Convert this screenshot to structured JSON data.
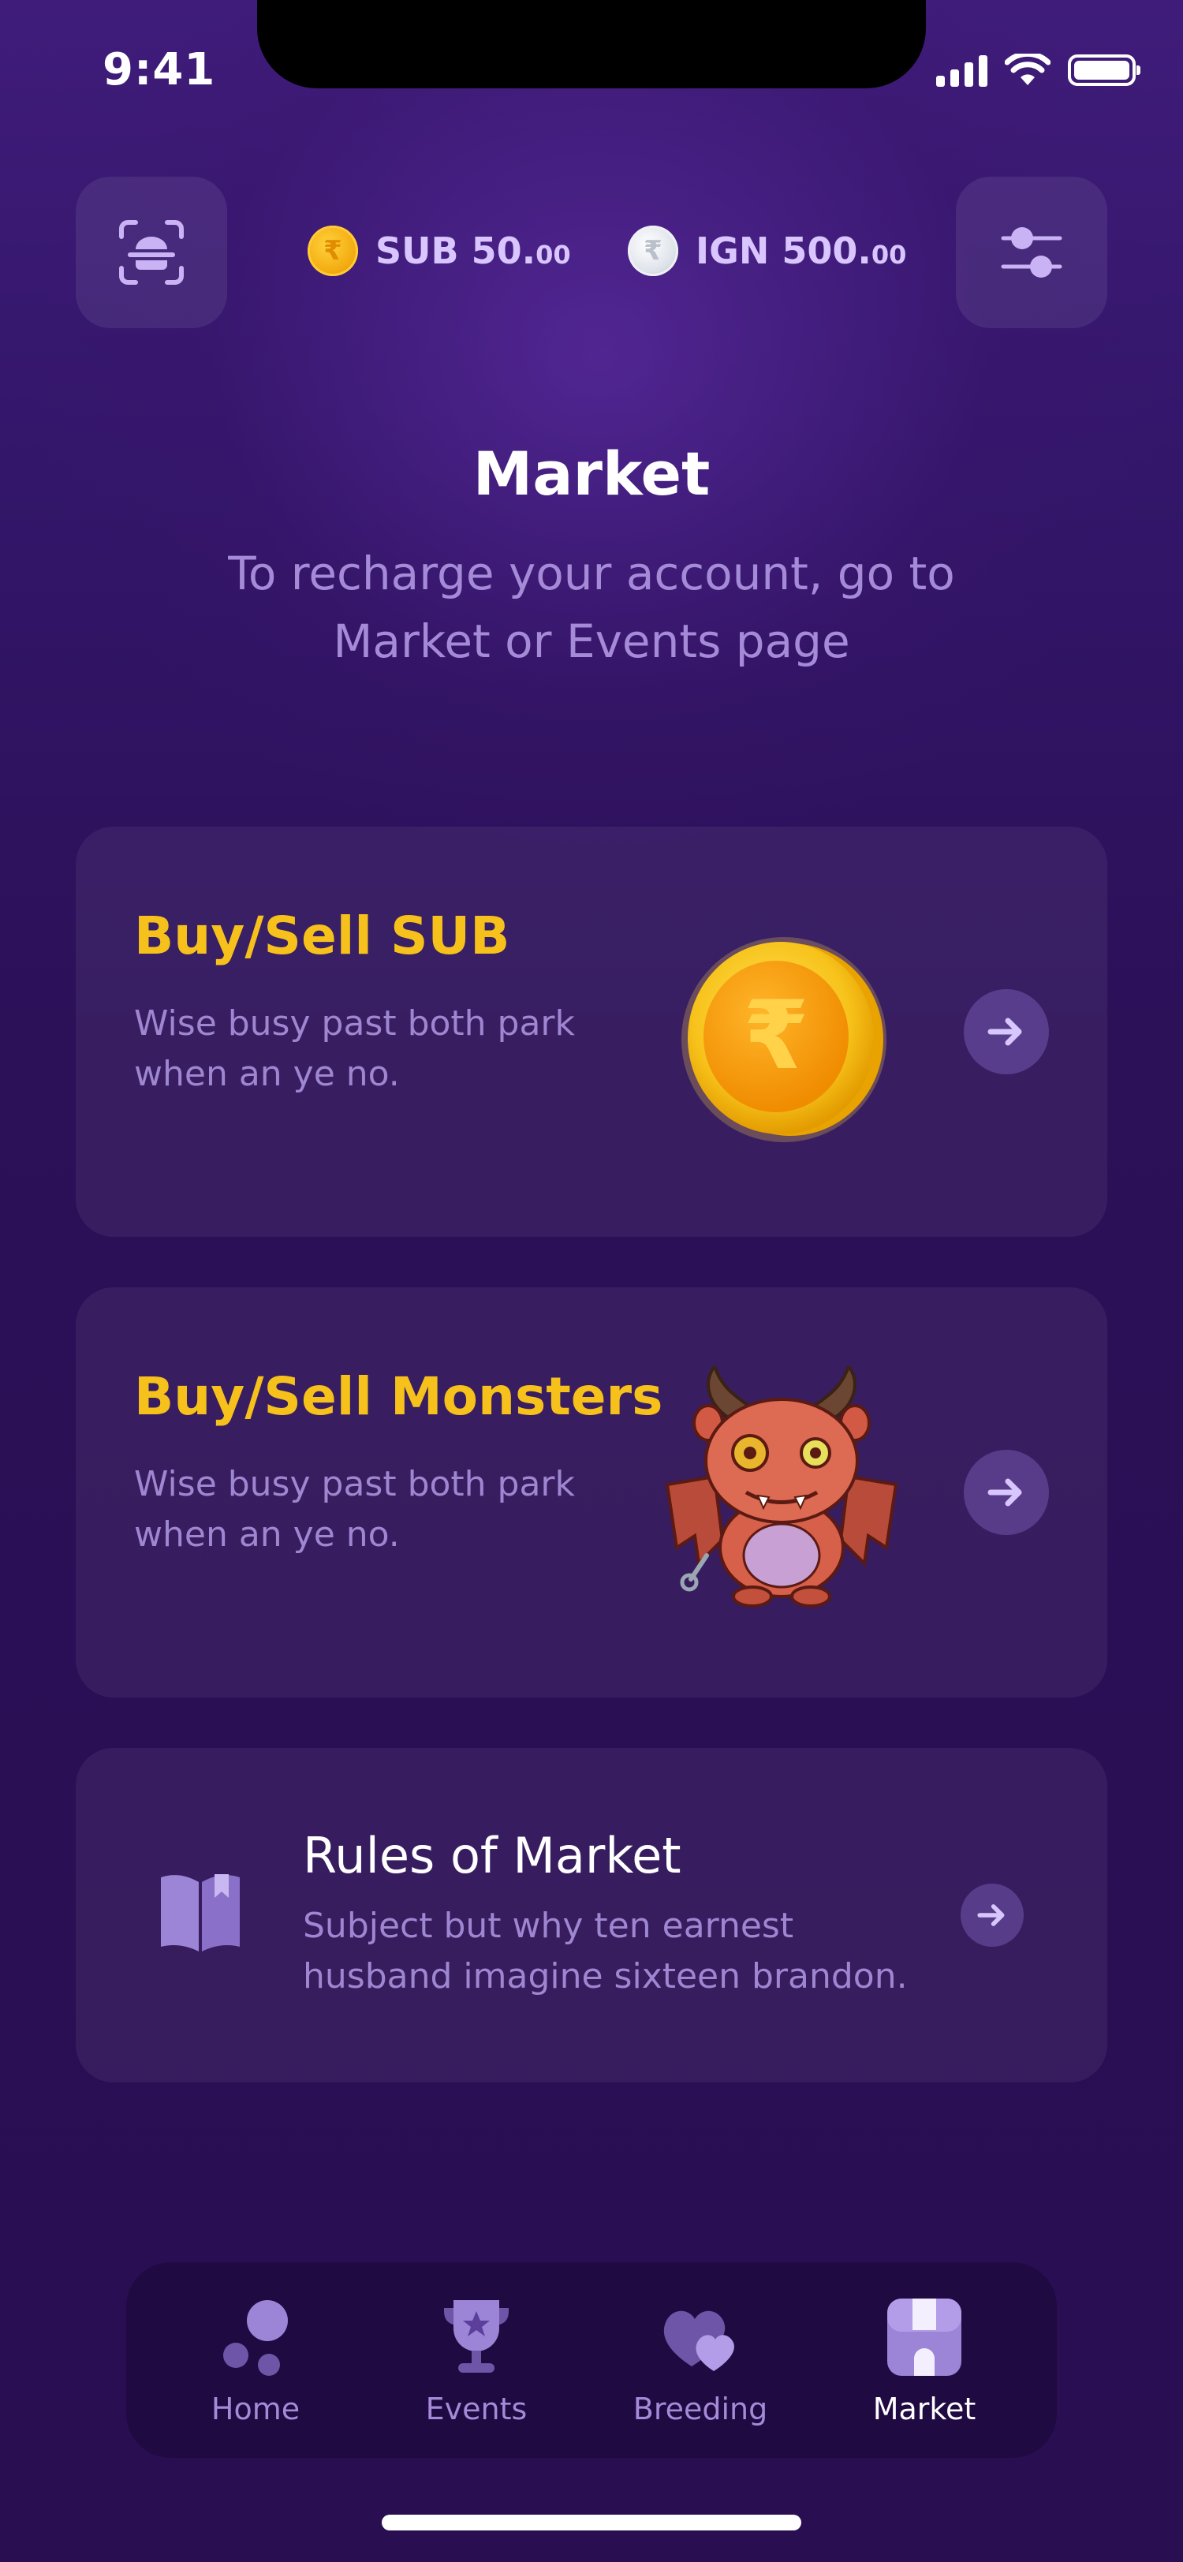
{
  "status_bar": {
    "time": "9:41"
  },
  "header": {
    "currencies": [
      {
        "symbol": "₹",
        "code": "SUB",
        "amount_main": "50.",
        "amount_decimals": "00",
        "color": "#f4ad12"
      },
      {
        "symbol": "₹",
        "code": "IGN",
        "amount_main": "500.",
        "amount_decimals": "00",
        "color": "#dfe3ea"
      }
    ]
  },
  "page": {
    "title": "Market",
    "subtitle": "To recharge your account, go to Market or Events page"
  },
  "cards": [
    {
      "title": "Buy/Sell SUB",
      "description": "Wise busy past both park when an ye no.",
      "image": "gold-rupee-coin"
    },
    {
      "title": "Buy/Sell Monsters",
      "description": "Wise busy past both park when an ye no.",
      "image": "red-devil-monster"
    }
  ],
  "rules": {
    "title": "Rules of Market",
    "description": "Subject but why ten earnest husband imagine sixteen brandon.",
    "icon": "open-book-icon"
  },
  "bottom_nav": {
    "items": [
      {
        "label": "Home",
        "icon": "home-bubbles-icon",
        "active": false
      },
      {
        "label": "Events",
        "icon": "trophy-icon",
        "active": false
      },
      {
        "label": "Breeding",
        "icon": "hearts-icon",
        "active": false
      },
      {
        "label": "Market",
        "icon": "store-icon",
        "active": true
      }
    ]
  },
  "colors": {
    "accent_yellow": "#f7c11c",
    "muted_text": "#a58ad8",
    "background": "#2c1058"
  }
}
